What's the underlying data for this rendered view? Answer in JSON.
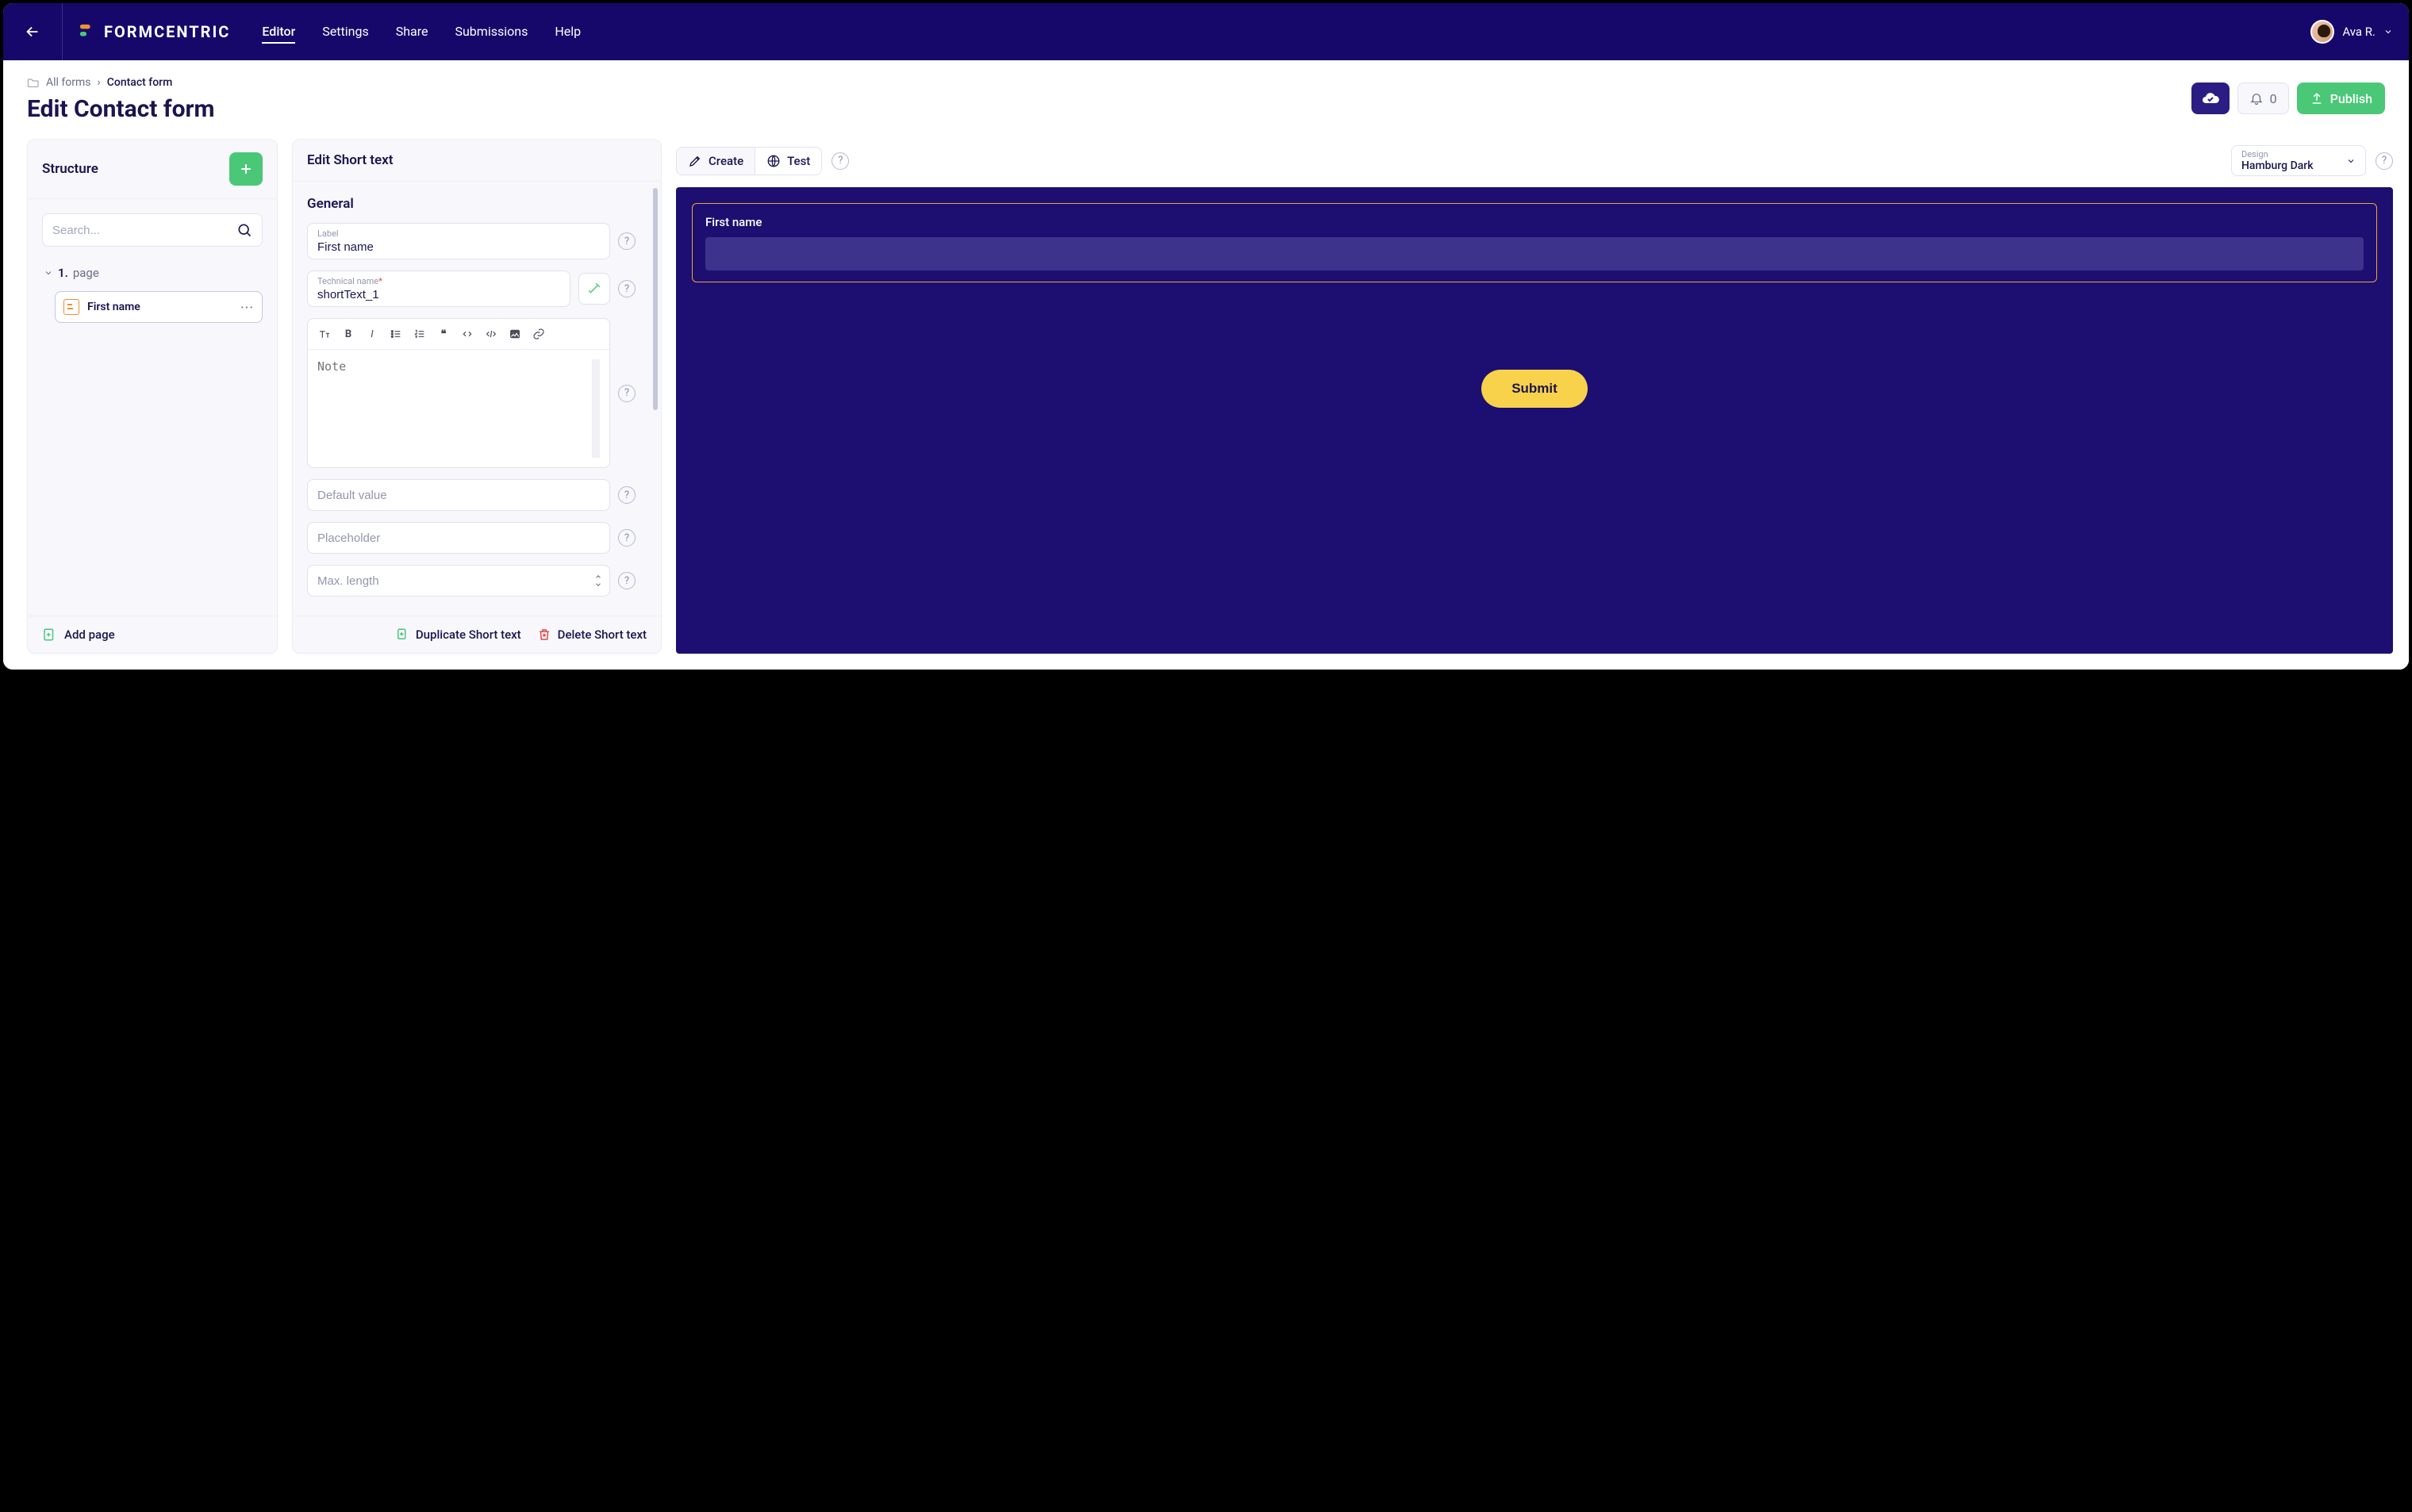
{
  "nav": {
    "brand": "FORMCENTRIC",
    "items": [
      "Editor",
      "Settings",
      "Share",
      "Submissions",
      "Help"
    ],
    "active_index": 0,
    "user": "Ava R."
  },
  "breadcrumb": {
    "root": "All forms",
    "current": "Contact form"
  },
  "page_title": "Edit Contact form",
  "actions": {
    "notif_count": "0",
    "publish": "Publish"
  },
  "structure": {
    "title": "Structure",
    "search_placeholder": "Search...",
    "page_num": "1.",
    "page_label": "page",
    "child_label": "First name",
    "add_page": "Add page"
  },
  "edit": {
    "title": "Edit Short text",
    "general": "General",
    "label_label": "Label",
    "label_value": "First name",
    "tech_label": "Technical name",
    "tech_value": "shortText_1",
    "note_placeholder": "Note",
    "default_placeholder": "Default value",
    "placeholder_placeholder": "Placeholder",
    "maxlen_placeholder": "Max. length",
    "duplicate": "Duplicate Short text",
    "delete": "Delete Short text"
  },
  "preview": {
    "create": "Create",
    "test": "Test",
    "design_label": "Design",
    "design_value": "Hamburg Dark",
    "field_label": "First name",
    "submit": "Submit"
  }
}
